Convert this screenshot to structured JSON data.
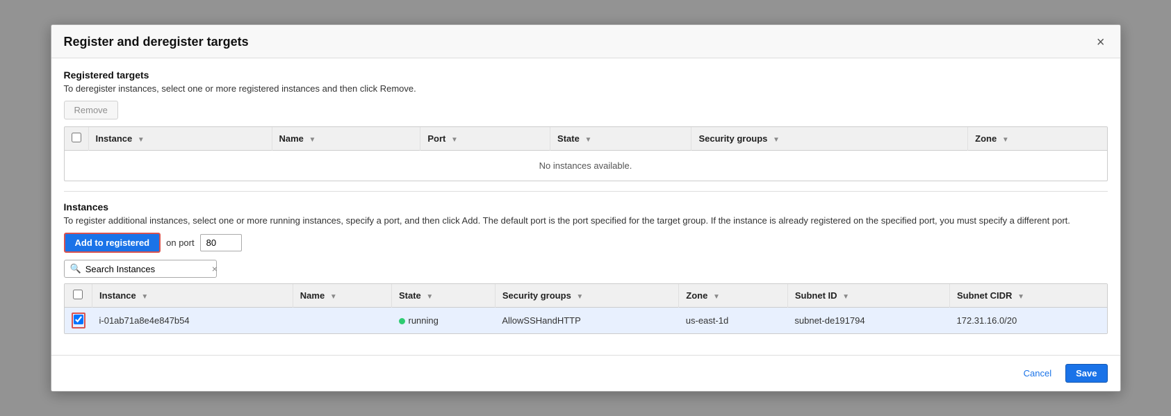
{
  "modal": {
    "title": "Register and deregister targets",
    "close_label": "×"
  },
  "registered_targets": {
    "section_title": "Registered targets",
    "description": "To deregister instances, select one or more registered instances and then click Remove.",
    "remove_button": "Remove",
    "table": {
      "columns": [
        {
          "key": "instance",
          "label": "Instance"
        },
        {
          "key": "name",
          "label": "Name"
        },
        {
          "key": "port",
          "label": "Port"
        },
        {
          "key": "state",
          "label": "State"
        },
        {
          "key": "security_groups",
          "label": "Security groups"
        },
        {
          "key": "zone",
          "label": "Zone"
        }
      ],
      "empty_message": "No instances available.",
      "rows": []
    }
  },
  "instances": {
    "section_title": "Instances",
    "description": "To register additional instances, select one or more running instances, specify a port, and then click Add. The default port is the port specified for the target group. If the instance is already registered on the specified port, you must specify a different port.",
    "add_button": "Add to registered",
    "port_label": "on port",
    "port_value": "80",
    "search_placeholder": "Search Instances",
    "search_clear": "×",
    "table": {
      "columns": [
        {
          "key": "instance",
          "label": "Instance"
        },
        {
          "key": "name",
          "label": "Name"
        },
        {
          "key": "state",
          "label": "State"
        },
        {
          "key": "security_groups",
          "label": "Security groups"
        },
        {
          "key": "zone",
          "label": "Zone"
        },
        {
          "key": "subnet_id",
          "label": "Subnet ID"
        },
        {
          "key": "subnet_cidr",
          "label": "Subnet CIDR"
        }
      ],
      "rows": [
        {
          "selected": true,
          "instance": "i-01ab71a8e4e847b54",
          "name": "",
          "state": "running",
          "security_groups": "AllowSSHandHTTP",
          "zone": "us-east-1d",
          "subnet_id": "subnet-de191794",
          "subnet_cidr": "172.31.16.0/20"
        }
      ]
    }
  },
  "footer": {
    "cancel_label": "Cancel",
    "save_label": "Save"
  }
}
